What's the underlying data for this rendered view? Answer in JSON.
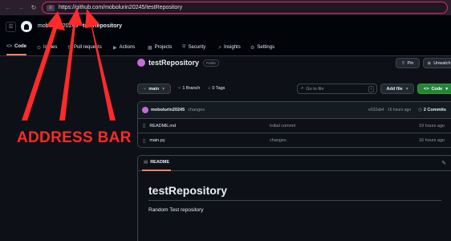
{
  "browser": {
    "url": "https://github.com/mobolurin20245/testRepository"
  },
  "header": {
    "owner": "mobolurin20245",
    "separator": "/",
    "repo": "testRepository"
  },
  "tabs": [
    {
      "label": "Code",
      "icon": "code-icon",
      "active": true
    },
    {
      "label": "Issues",
      "icon": "issues-icon"
    },
    {
      "label": "Pull requests",
      "icon": "pull-request-icon"
    },
    {
      "label": "Actions",
      "icon": "actions-icon"
    },
    {
      "label": "Projects",
      "icon": "projects-icon"
    },
    {
      "label": "Security",
      "icon": "shield-icon"
    },
    {
      "label": "Insights",
      "icon": "insights-icon"
    },
    {
      "label": "Settings",
      "icon": "gear-icon"
    }
  ],
  "repo": {
    "title": "testRepository",
    "visibility": "Public",
    "pin_label": "Pin",
    "unwatch_label": "Unwatch",
    "branch": "main",
    "branches": "1 Branch",
    "tags": "0 Tags",
    "search_placeholder": "Go to file",
    "search_shortcut": "t",
    "add_file_label": "Add file",
    "code_label": "Code"
  },
  "commit": {
    "user": "mobolurin20245",
    "message": "changes",
    "hash_time": "e032ab4 · 16 hours ago",
    "count": "2 Commits"
  },
  "files": [
    {
      "name": "README.md",
      "message": "Initial commit",
      "time": "19 hours ago"
    },
    {
      "name": "main.py",
      "message": "changes",
      "time": "16 hours ago"
    }
  ],
  "readme": {
    "tab_label": "README",
    "heading": "testRepository",
    "body": "Random Test repository"
  },
  "annotation": {
    "label": "ADDRESS BAR",
    "color": "#ff2a2a"
  }
}
